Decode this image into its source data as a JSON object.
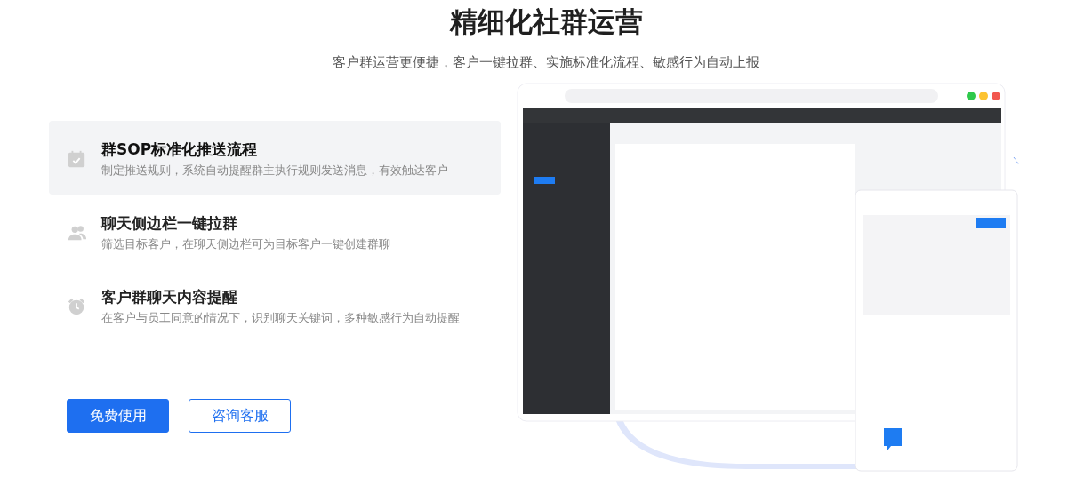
{
  "heading": "精细化社群运营",
  "subheading": "客户群运营更便捷，客户一键拉群、实施标准化流程、敏感行为自动上报",
  "features": [
    {
      "title": "群SOP标准化推送流程",
      "description": "制定推送规则，系统自动提醒群主执行规则发送消息，有效触达客户",
      "selected": true
    },
    {
      "title": "聊天侧边栏一键拉群",
      "description": "筛选目标客户，在聊天侧边栏可为目标客户一键创建群聊",
      "selected": false
    },
    {
      "title": "客户群聊天内容提醒",
      "description": "在客户与员工同意的情况下，识别聊天关键词，多种敏感行为自动提醒",
      "selected": false
    }
  ],
  "buttons": [
    {
      "label": "免费使用",
      "kind": "primary"
    },
    {
      "label": "咨询客服",
      "kind": "outline"
    }
  ]
}
